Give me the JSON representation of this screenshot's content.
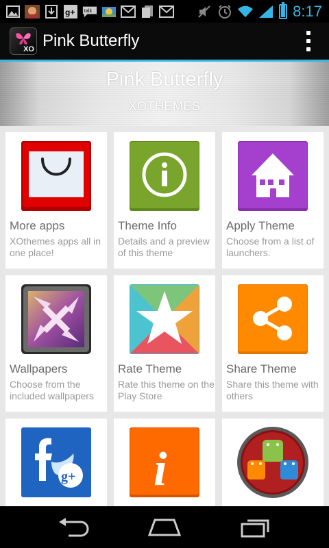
{
  "status_bar": {
    "time": "8:17",
    "left_icons": [
      "gallery-icon",
      "avatar-notification-icon",
      "download-icon",
      "google-plus-icon",
      "talk-icon",
      "photo-icon",
      "gmail-icon",
      "docs-icon",
      "gmail-icon"
    ],
    "right_icons": [
      "mute-icon",
      "alarm-icon",
      "wifi-icon",
      "signal-icon",
      "battery-icon"
    ],
    "battery_level": 0.9
  },
  "action_bar": {
    "app_icon_text": "XO",
    "title": "Pink Butterfly",
    "overflow_icon": "overflow-menu-icon"
  },
  "banner": {
    "title": "Pink Butterfly",
    "subtitle": "XOTHEMES"
  },
  "colors": {
    "accent": "#33b5e5",
    "more_apps": "#e10000",
    "theme_info": "#79a52c",
    "apply_theme": "#a53fce",
    "share_theme": "#ff8a00",
    "info_orange": "#ff6a00",
    "social_blue": "#1f64c0"
  },
  "cards": [
    {
      "title": "More apps",
      "desc": "XOthemes apps all in one place!",
      "icon": "shopping-bag-icon"
    },
    {
      "title": "Theme Info",
      "desc": "Details and a preview of this theme",
      "icon": "info-circle-icon"
    },
    {
      "title": "Apply Theme",
      "desc": "Choose from a list of launchers.",
      "icon": "house-icon"
    },
    {
      "title": "Wallpapers",
      "desc": "Choose from the included wallpapers",
      "icon": "wallpaper-icon"
    },
    {
      "title": "Rate Theme",
      "desc": "Rate this theme on the Play Store",
      "icon": "star-icon"
    },
    {
      "title": "Share Theme",
      "desc": "Share this theme with others",
      "icon": "share-icon"
    },
    {
      "title": "",
      "desc": "",
      "icon": "social-icon"
    },
    {
      "title": "",
      "desc": "",
      "icon": "info-italic-icon"
    },
    {
      "title": "",
      "desc": "",
      "icon": "android-icon"
    }
  ],
  "nav_bar": {
    "icons": [
      "back-icon",
      "home-icon",
      "recents-icon"
    ]
  }
}
